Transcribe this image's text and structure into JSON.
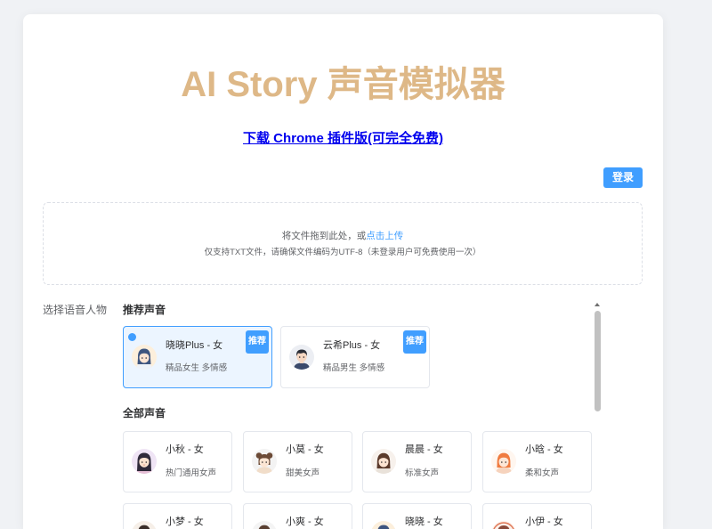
{
  "app": {
    "title": "AI Story 声音模拟器",
    "download_link": "下载 Chrome 插件版(可完全免费)",
    "login_button": "登录"
  },
  "upload": {
    "prompt": "将文件拖到此处，或",
    "link": "点击上传",
    "hint": "仅支持TXT文件，请确保文件编码为UTF-8（未登录用户可免费使用一次）"
  },
  "voice_picker": {
    "label": "选择语音人物",
    "recommended_heading": "推荐声音",
    "recommended": [
      {
        "name": "晓晓Plus - 女",
        "desc": "精品女生 多情感",
        "badge": "推荐",
        "selected": true,
        "avatar_icon": "girl-avatar-icon"
      },
      {
        "name": "云希Plus - 女",
        "desc": "精品男生 多情感",
        "badge": "推荐",
        "selected": false,
        "avatar_icon": "boy-avatar-icon"
      }
    ],
    "all_heading": "全部声音",
    "all": [
      {
        "name": "小秋 - 女",
        "desc": "热门通用女声",
        "avatar_icon": "girl-avatar-icon"
      },
      {
        "name": "小莫 - 女",
        "desc": "甜美女声",
        "avatar_icon": "girl-avatar-icon"
      },
      {
        "name": "晨晨 - 女",
        "desc": "标准女声",
        "avatar_icon": "girl-avatar-icon"
      },
      {
        "name": "小晗 - 女",
        "desc": "柔和女声",
        "avatar_icon": "girl-avatar-icon"
      },
      {
        "name": "小梦 - 女",
        "avatar_icon": "girl-avatar-icon"
      },
      {
        "name": "小爽 - 女",
        "avatar_icon": "girl-avatar-icon"
      },
      {
        "name": "晓晓 - 女",
        "avatar_icon": "girl-avatar-icon"
      },
      {
        "name": "小伊 - 女",
        "avatar_icon": "girl-avatar-icon"
      }
    ]
  },
  "colors": {
    "title": "#deb887",
    "primary": "#409eff",
    "link": "#0000ee",
    "selected_bg": "#ecf5ff"
  }
}
